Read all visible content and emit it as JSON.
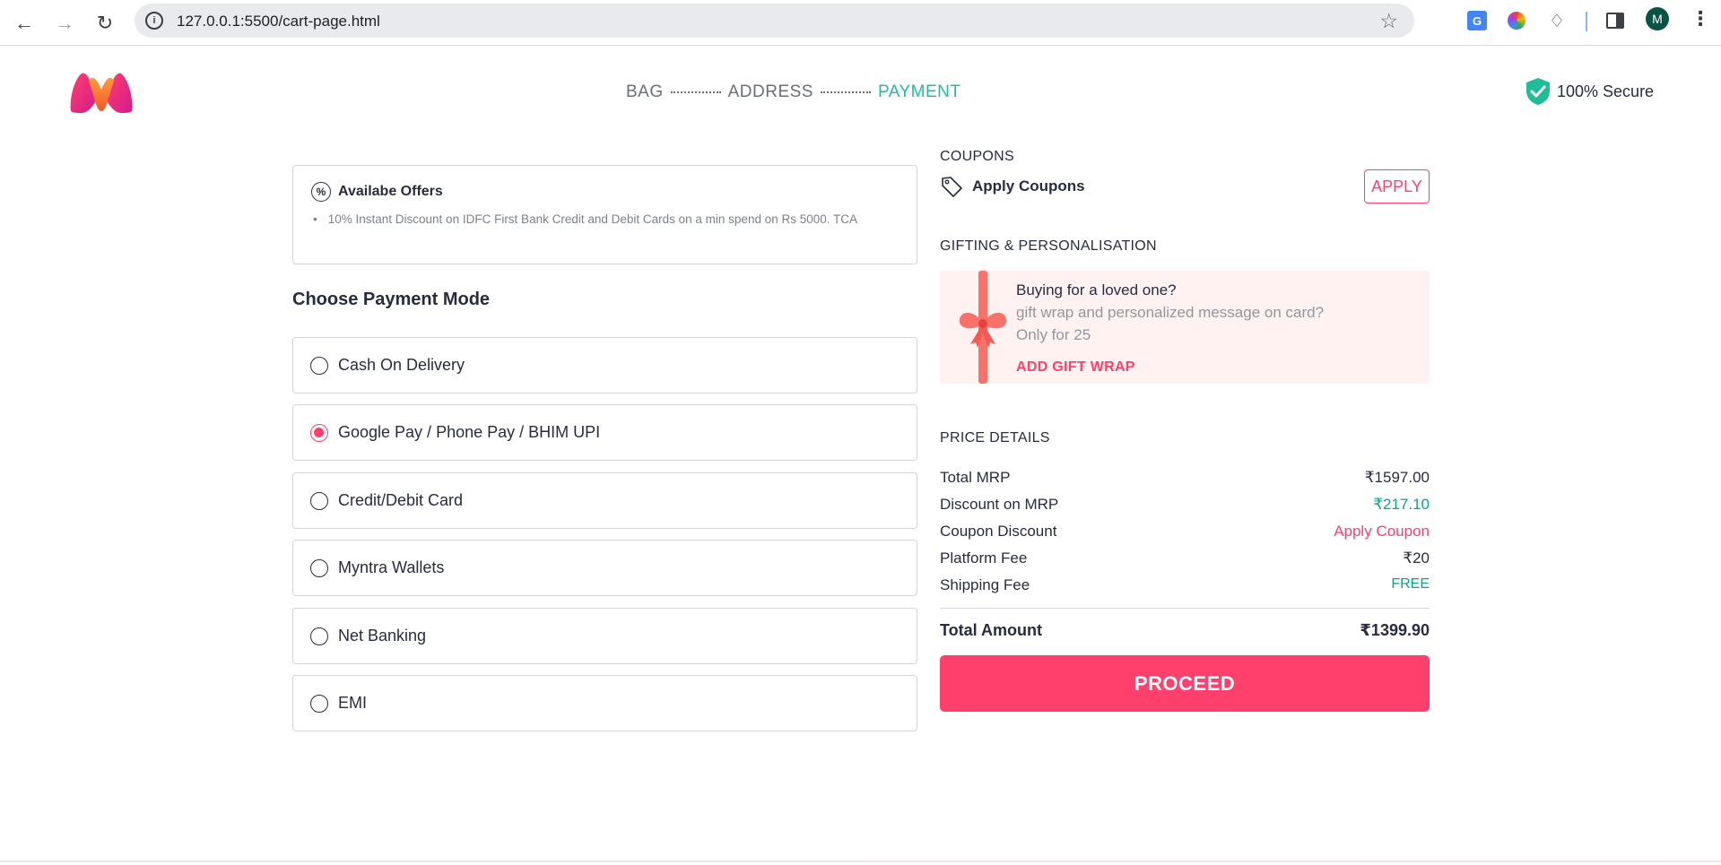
{
  "browser": {
    "url": "127.0.0.1:5500/cart-page.html",
    "avatar_letter": "M"
  },
  "colors": {
    "brand_pink": "#ff3f6c",
    "active_step": "#20bd99",
    "discount_green": "#03a685"
  },
  "header": {
    "steps": [
      "BAG",
      "ADDRESS",
      "PAYMENT"
    ],
    "active_step": "PAYMENT",
    "secure_label": "100% Secure"
  },
  "offers": {
    "title": "Availabe Offers",
    "items": [
      "10% Instant Discount on IDFC First Bank Credit and Debit Cards on a min spend on Rs 5000. TCA"
    ]
  },
  "payment": {
    "title": "Choose Payment Mode",
    "options": [
      {
        "label": "Cash On Delivery",
        "selected": false
      },
      {
        "label": "Google Pay / Phone Pay / BHIM UPI",
        "selected": true
      },
      {
        "label": "Credit/Debit Card",
        "selected": false
      },
      {
        "label": "Myntra Wallets",
        "selected": false
      },
      {
        "label": "Net Banking",
        "selected": false
      },
      {
        "label": "EMI",
        "selected": false
      }
    ]
  },
  "coupons": {
    "title": "COUPONS",
    "label": "Apply Coupons",
    "button": "APPLY"
  },
  "gifting": {
    "title": "GIFTING & PERSONALISATION",
    "heading": "Buying for a loved one?",
    "subtext": "gift wrap and personalized message on card?",
    "price_text": "Only for 25",
    "link": "ADD GIFT WRAP"
  },
  "price_details": {
    "title": "PRICE DETAILS",
    "rows": [
      {
        "label": "Total MRP",
        "value": "₹1597.00"
      },
      {
        "label": "Discount on MRP",
        "value": "₹217.10"
      },
      {
        "label": "Coupon Discount",
        "value": "Apply Coupon"
      },
      {
        "label": "Platform Fee",
        "value": "₹20"
      },
      {
        "label": "Shipping Fee",
        "value": "FREE"
      }
    ],
    "total_label": "Total Amount",
    "total_value": "₹1399.90",
    "proceed_label": "PROCEED"
  }
}
